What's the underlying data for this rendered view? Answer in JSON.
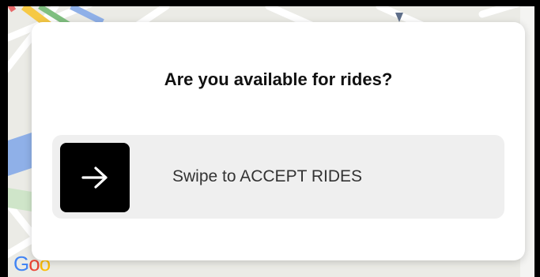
{
  "map": {
    "attribution_letters": [
      "G",
      "o",
      "o"
    ]
  },
  "dialog": {
    "title": "Are you available for rides?",
    "swipe_control": {
      "label": "Swipe to ACCEPT RIDES",
      "handle_icon": "arrow-right-icon"
    }
  },
  "colors": {
    "handle": "#000000",
    "track": "#efefef",
    "card": "#ffffff"
  }
}
